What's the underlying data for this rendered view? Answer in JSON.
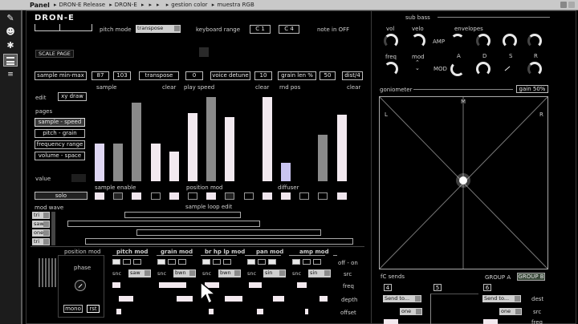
{
  "toolbar": {
    "panel": "Panel",
    "crumbs": [
      "DRON-E Release",
      "DRON-E",
      "gestion color",
      "muestra RGB"
    ],
    "sidebar_icons": [
      "wrench-icon",
      "face-icon",
      "bug-icon",
      "panel-icon",
      "list-icon"
    ]
  },
  "header": {
    "logo": "DRON-E",
    "pitch_mode_label": "pitch mode",
    "pitch_mode_value": "transpose",
    "keyboard_range_label": "keyboard range",
    "kb_low": "C  1",
    "kb_high": "C  4",
    "note_in_label": "note in  OFF"
  },
  "scale_page": "SCALE PAGE",
  "params": {
    "sample_minmax_label": "sample min-max",
    "sample_min": "87",
    "sample_max": "103",
    "transpose_label": "transpose",
    "transpose_value": "0",
    "voice_detune_label": "voice detune",
    "voice_detune_value": "10",
    "grain_len_label": "grain len %",
    "grain_len_value": "50",
    "dist_label": "dist/4"
  },
  "seq": {
    "headers": [
      "sample",
      "clear",
      "play speed",
      "clear",
      "rnd pos",
      "clear"
    ],
    "edit_label": "edit",
    "xy_draw": "xy draw",
    "pages_label": "pages",
    "pages": [
      "sample - speed",
      "pitch - grain",
      "frequency range",
      "volume - space"
    ],
    "value_label": "value",
    "bar_levels": [
      0.45,
      0.45,
      0.93,
      0.45,
      0.35,
      0.81,
      1.0,
      0.76,
      0.0,
      1.0,
      0.22,
      0.0,
      0.55,
      0.79
    ],
    "bar_colors": [
      "#ded6f2",
      "#8a8a8a",
      "#8a8a8a",
      "#f2e9ef",
      "#f2e9ef",
      "#f2e9ef",
      "#8a8a8a",
      "#f2e9ef",
      "#8a8a8a",
      "#f2e9ef",
      "#c9c4f0",
      "#8a8a8a",
      "#8a8a8a",
      "#f2e9ef"
    ],
    "enable_labels": [
      "sample enable",
      "position mod",
      "diffuser"
    ],
    "solo": "solo",
    "mod_wave_label": "mod wave",
    "sample_loop_edit": "sample loop edit",
    "waves": [
      "tri",
      "saw",
      "one",
      "tri"
    ]
  },
  "mod": {
    "position_mod": "position mod",
    "phase": "phase",
    "mono": "mono",
    "rst": "rst",
    "columns": [
      "pitch mod",
      "grain mod",
      "br hp lp mod",
      "pan mod",
      "amp mod"
    ],
    "snc": "snc",
    "col_values": [
      "saw",
      "bwn",
      "bwn",
      "sin",
      "sin"
    ],
    "right_labels": [
      "off - on",
      "src",
      "freq",
      "depth",
      "offset"
    ]
  },
  "subbass": {
    "title": "sub bass",
    "vol": "vol",
    "velo": "velo",
    "envelopes": "envelopes",
    "amp": "AMP",
    "freq": "freq",
    "mod": "mod",
    "adsr": [
      "A",
      "D",
      "S",
      "R"
    ],
    "mod_row": "MOD"
  },
  "goniometer": {
    "title": "goniometer",
    "gain": "gain 50%",
    "L": "L",
    "M": "M",
    "R": "R"
  },
  "sends": {
    "title": "fC sends",
    "ch4": "4",
    "ch5": "5",
    "ch6": "6",
    "group_a": "GROUP A",
    "group_b": "GROUP B",
    "send_to": "Send to...",
    "one": "one",
    "dest": "dest",
    "src": "src",
    "freq": "freq"
  }
}
